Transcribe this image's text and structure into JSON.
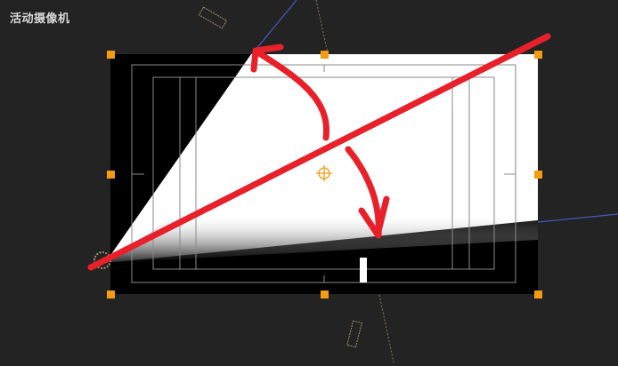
{
  "viewport": {
    "view_label": "活动摄像机"
  },
  "colors": {
    "background": "#232323",
    "comp_frame": "#000000",
    "layer_fill": "#ffffff",
    "handle": "#f39c12",
    "annotation": "#e8202a",
    "guide_line": "#4a58c0",
    "dotted_path": "#8a7a5a",
    "safe_guides": "#8a8a8a"
  },
  "icons": {
    "anchor_point": "anchor-point-icon",
    "camera": "camera-icon",
    "selection_handle": "selection-handle"
  }
}
